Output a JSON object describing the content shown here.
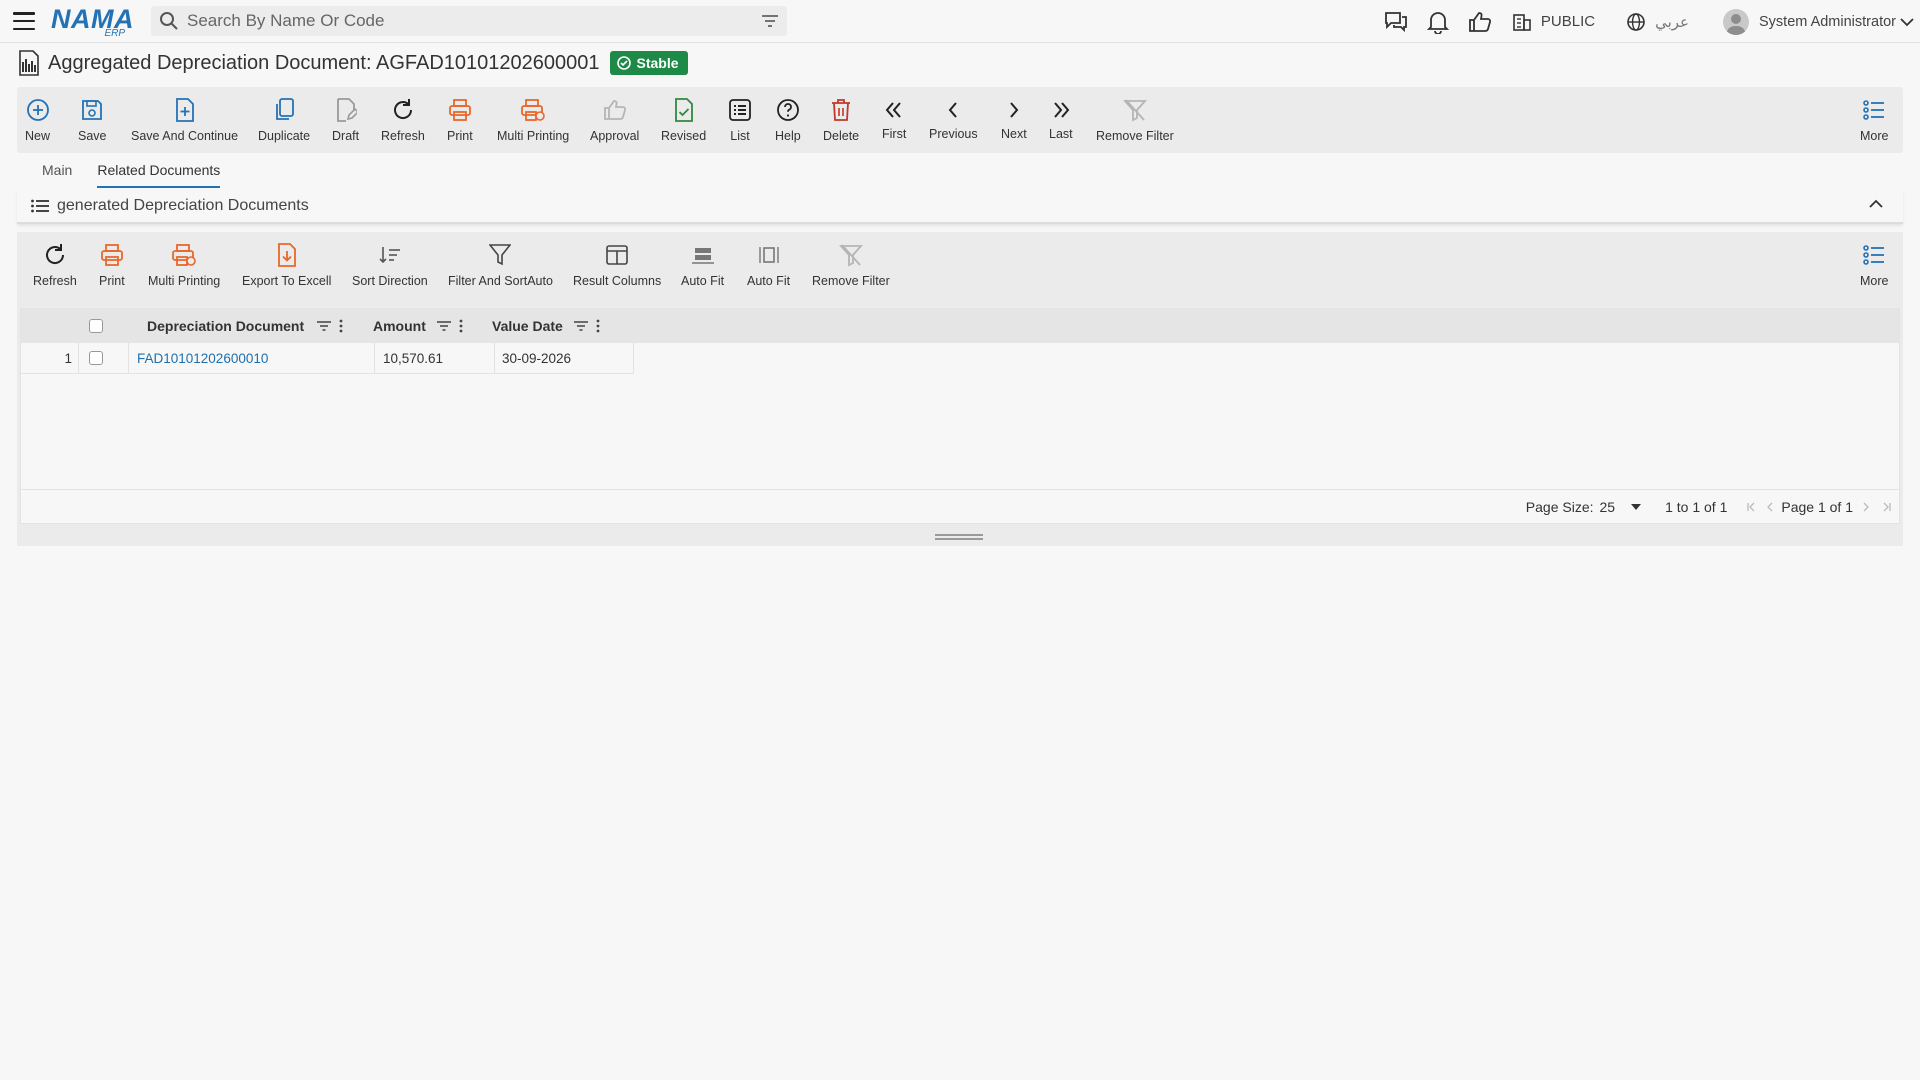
{
  "header": {
    "logo": "NAMA",
    "logo_sub": "ERP",
    "search_placeholder": "Search By Name Or Code",
    "branch": "PUBLIC",
    "language": "عربي",
    "user": "System Administrator"
  },
  "document": {
    "title": "Aggregated Depreciation Document: AGFAD10101202600001",
    "status": "Stable"
  },
  "toolbar": {
    "new": "New",
    "save": "Save",
    "save_continue": "Save And Continue",
    "duplicate": "Duplicate",
    "draft": "Draft",
    "refresh": "Refresh",
    "print": "Print",
    "multi_printing": "Multi Printing",
    "approval": "Approval",
    "revised": "Revised",
    "list": "List",
    "help": "Help",
    "delete": "Delete",
    "first": "First",
    "previous": "Previous",
    "next": "Next",
    "last": "Last",
    "remove_filter": "Remove Filter",
    "more": "More"
  },
  "tabs": {
    "main": "Main",
    "related": "Related Documents"
  },
  "section": {
    "title": "generated Depreciation Documents"
  },
  "grid_toolbar": {
    "refresh": "Refresh",
    "print": "Print",
    "multi_printing": "Multi Printing",
    "export": "Export To Excell",
    "sort_direction": "Sort Direction",
    "filter_sort": "Filter And SortAuto",
    "result_columns": "Result Columns",
    "auto_fit_1": "Auto Fit",
    "auto_fit_2": "Auto Fit",
    "remove_filter": "Remove Filter",
    "more": "More"
  },
  "grid": {
    "columns": {
      "doc": "Depreciation Document",
      "amount": "Amount",
      "date": "Value Date"
    },
    "rows": [
      {
        "num": "1",
        "doc": "FAD10101202600010",
        "amount": "10,570.61",
        "date": "30-09-2026"
      }
    ],
    "footer": {
      "page_size_label": "Page Size:",
      "page_size": "25",
      "range": "1 to 1 of 1",
      "page": "Page 1 of 1"
    }
  },
  "colors": {
    "accent": "#2472b6",
    "print": "#e8672b",
    "delete": "#c0392b",
    "status": "#1e8a47",
    "revised": "#2e8b3e"
  }
}
